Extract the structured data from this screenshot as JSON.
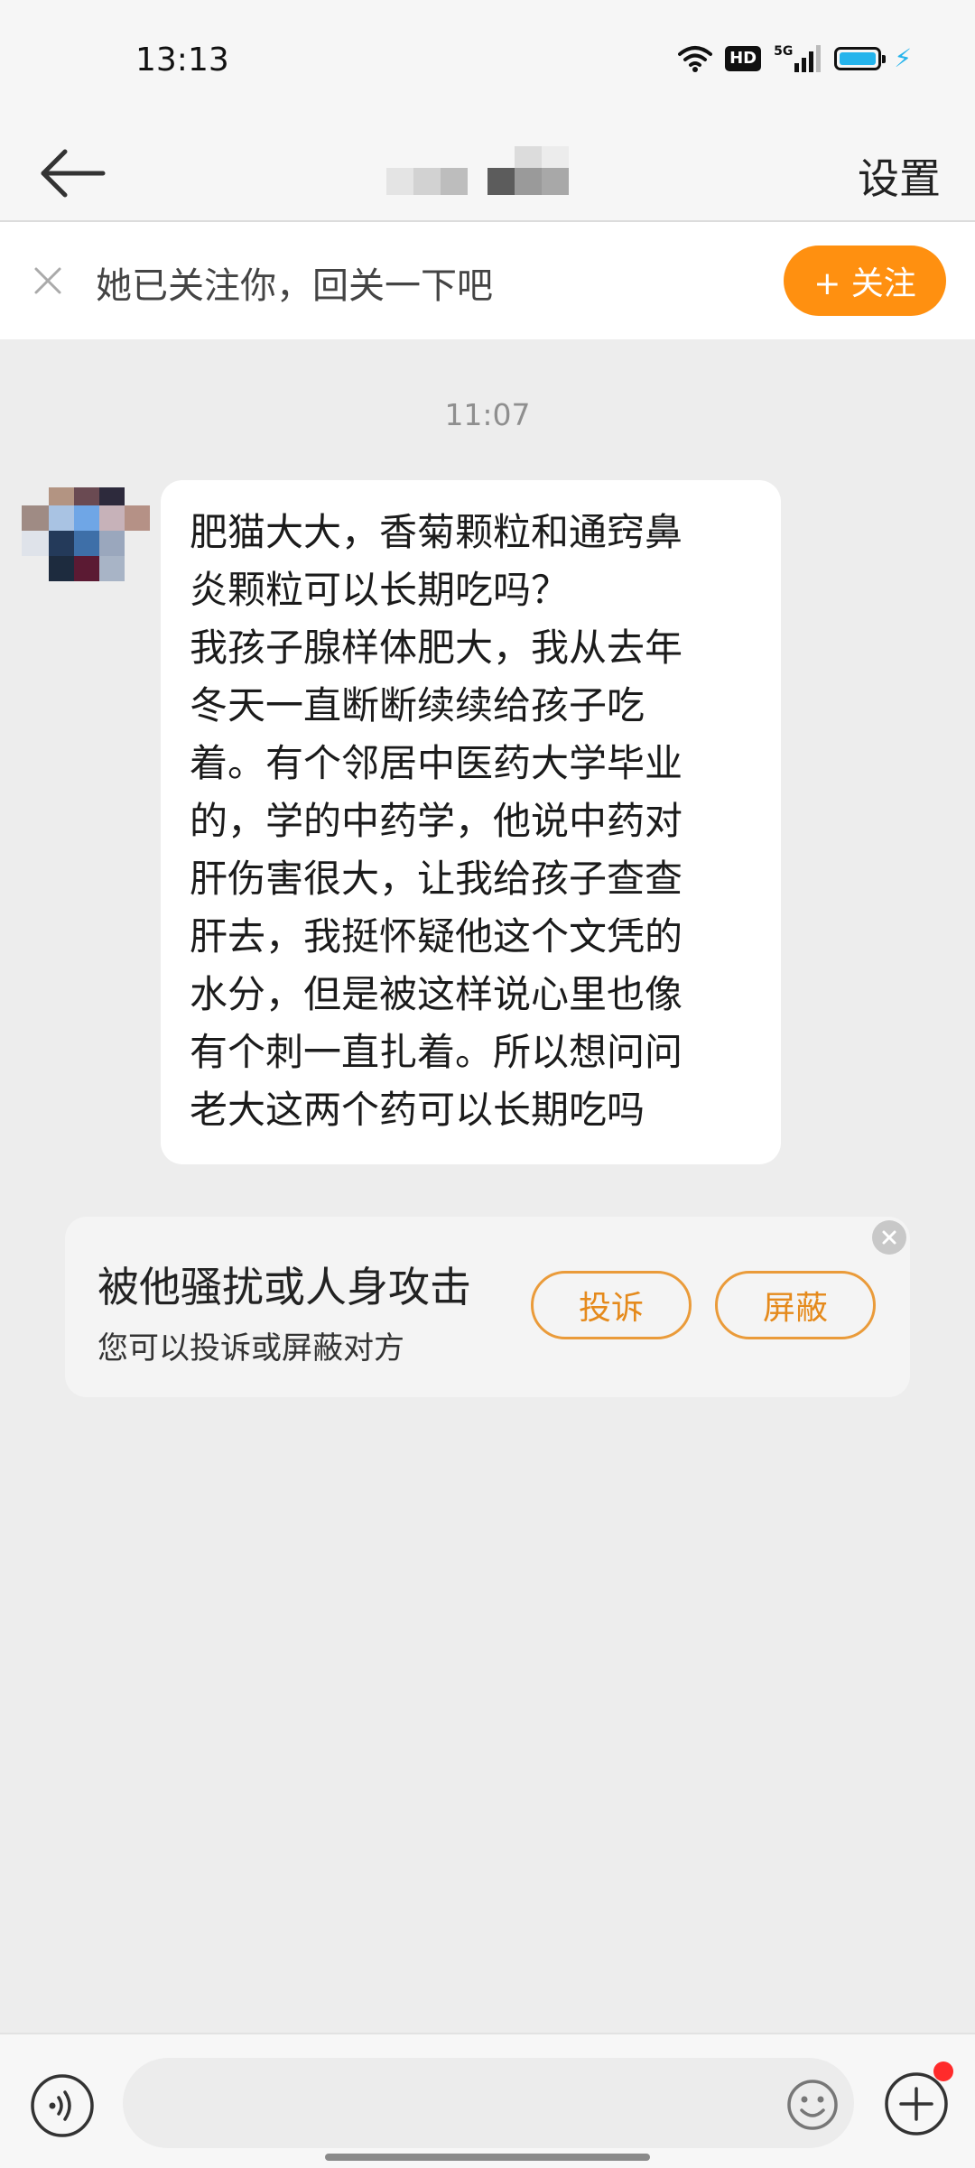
{
  "status_bar": {
    "time": "13:13",
    "hd": "HD",
    "network": "5G",
    "icons": [
      "wifi-icon",
      "signal-icon",
      "battery-icon",
      "charging-icon"
    ]
  },
  "header": {
    "back_icon": "arrow-left-icon",
    "settings_label": "设置"
  },
  "follow_banner": {
    "text": "她已关注你，回关一下吧",
    "button_label": "+ 关注",
    "accent_color": "#ff9010"
  },
  "chat": {
    "timestamp": "11:07",
    "message": "肥猫大大，香菊颗粒和通窍鼻\n炎颗粒可以长期吃吗？\n我孩子腺样体肥大，我从去年\n冬天一直断断续续给孩子吃\n着。有个邻居中医药大学毕业\n的，学的中药学，他说中药对\n肝伤害很大，让我给孩子查查\n肝去，我挺怀疑他这个文凭的\n水分，但是被这样说心里也像\n有个刺一直扎着。所以想问问\n老大这两个药可以长期吃吗"
  },
  "report_card": {
    "title": "被他骚扰或人身攻击",
    "subtitle": "您可以投诉或屏蔽对方",
    "complain_label": "投诉",
    "block_label": "屏蔽"
  },
  "input_bar": {
    "placeholder": "",
    "icons": [
      "voice-icon",
      "emoji-icon",
      "plus-icon"
    ]
  }
}
